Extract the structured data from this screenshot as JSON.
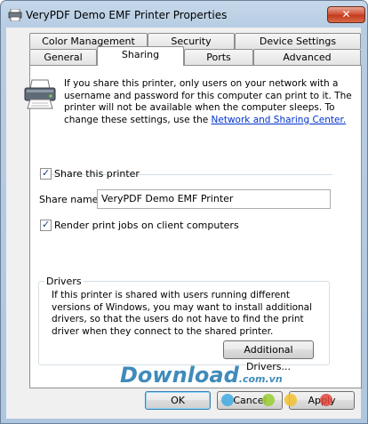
{
  "window": {
    "title": "VeryPDF Demo EMF Printer Properties",
    "close_glyph": "✕"
  },
  "tabs_row1": [
    {
      "label": "Color Management"
    },
    {
      "label": "Security"
    },
    {
      "label": "Device Settings"
    }
  ],
  "tabs_row2": [
    {
      "label": "General"
    },
    {
      "label": "Sharing",
      "active": true
    },
    {
      "label": "Ports"
    },
    {
      "label": "Advanced"
    }
  ],
  "sharing": {
    "intro_text": "If you share this printer, only users on your network with a username and password for this computer can print to it. The printer will not be available when the computer sleeps. To change these settings, use the ",
    "intro_link": "Network and Sharing Center.",
    "share_checkbox_label": "Share this printer",
    "share_checked": true,
    "share_name_label": "Share name:",
    "share_name_value": "VeryPDF Demo EMF Printer",
    "render_checkbox_label": "Render print jobs on client computers",
    "render_checked": true,
    "drivers_group_label": "Drivers",
    "drivers_text": "If this printer is shared with users running different versions of Windows, you may want to install additional drivers, so that the users do not have to find the print driver when they connect to the shared printer.",
    "additional_drivers_button": "Additional Drivers..."
  },
  "footer": {
    "ok": "OK",
    "cancel": "Cancel",
    "apply": "Apply"
  },
  "watermark": {
    "text": "Download",
    "suffix": ".com.vn"
  },
  "icons": {
    "printer": "printer-icon",
    "window_app": "printer-small-icon",
    "close": "close-icon"
  },
  "colors": {
    "link": "#0033cc",
    "close_button": "#c33b1e",
    "watermark": "#2c7fb3"
  }
}
